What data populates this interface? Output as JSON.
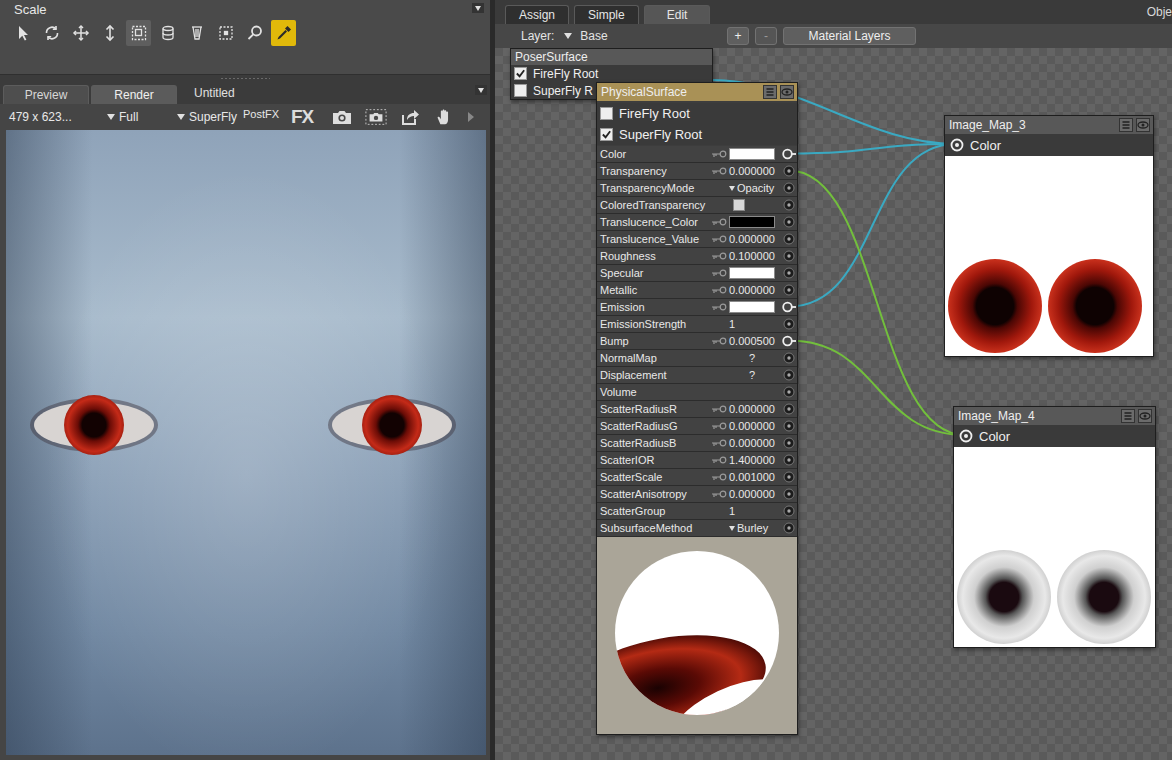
{
  "tool_panel": {
    "title": "Scale",
    "tools": [
      {
        "kind": "select",
        "selected": false,
        "highlighted": false
      },
      {
        "kind": "rotate",
        "selected": false,
        "highlighted": false
      },
      {
        "kind": "move",
        "selected": false,
        "highlighted": false
      },
      {
        "kind": "vertical",
        "selected": false,
        "highlighted": false
      },
      {
        "kind": "scale",
        "selected": false,
        "highlighted": true
      },
      {
        "kind": "layers",
        "selected": false,
        "highlighted": false
      },
      {
        "kind": "taper",
        "selected": false,
        "highlighted": false
      },
      {
        "kind": "region",
        "selected": false,
        "highlighted": false
      },
      {
        "kind": "zoom",
        "selected": false,
        "highlighted": false
      },
      {
        "kind": "eyedropper",
        "selected": true,
        "highlighted": false
      }
    ]
  },
  "render_panel": {
    "tabs": [
      {
        "label": "Preview",
        "selected": false
      },
      {
        "label": "Render",
        "selected": true
      }
    ],
    "document": "Untitled",
    "toolbar": {
      "size": "479 x 623...",
      "quality": "Full",
      "engine": "SuperFly",
      "postfx": "PostFX",
      "fx": "FX"
    }
  },
  "room_tabs": [
    {
      "label": "Assign",
      "selected": false
    },
    {
      "label": "Simple",
      "selected": false
    },
    {
      "label": "Edit",
      "selected": true
    }
  ],
  "corner_label": "Obje",
  "layer_bar": {
    "label": "Layer:",
    "value": "Base",
    "add": "+",
    "remove": "-",
    "remove_disabled": true,
    "button": "Material Layers"
  },
  "poser_surface": {
    "title": "PoserSurface",
    "roots": [
      {
        "label": "FireFly Root",
        "checked": true
      },
      {
        "label": "SuperFly R",
        "checked": false
      }
    ]
  },
  "physical_surface": {
    "title": "PhysicalSurface",
    "roots": [
      {
        "label": "FireFly Root",
        "checked": false
      },
      {
        "label": "SuperFly Root",
        "checked": true
      }
    ],
    "params": [
      {
        "name": "Color",
        "kind": "swatch",
        "color": "#ffffff",
        "keyed": true,
        "connected": true
      },
      {
        "name": "Transparency",
        "kind": "number",
        "value": "0.000000",
        "keyed": true,
        "connected": false
      },
      {
        "name": "TransparencyMode",
        "kind": "menu",
        "value": "Opacity",
        "keyed": false,
        "connected": false
      },
      {
        "name": "ColoredTransparency",
        "kind": "checkbox",
        "checked": false,
        "keyed": false,
        "connected": false
      },
      {
        "name": "Translucence_Color",
        "kind": "swatch",
        "color": "#000000",
        "keyed": true,
        "connected": false
      },
      {
        "name": "Translucence_Value",
        "kind": "number",
        "value": "0.000000",
        "keyed": true,
        "connected": false
      },
      {
        "name": "Roughness",
        "kind": "number",
        "value": "0.100000",
        "keyed": true,
        "connected": false
      },
      {
        "name": "Specular",
        "kind": "swatch",
        "color": "#ffffff",
        "keyed": true,
        "connected": false
      },
      {
        "name": "Metallic",
        "kind": "number",
        "value": "0.000000",
        "keyed": true,
        "connected": false
      },
      {
        "name": "Emission",
        "kind": "swatch",
        "color": "#ffffff",
        "keyed": true,
        "connected": true
      },
      {
        "name": "EmissionStrength",
        "kind": "number",
        "value": "1",
        "keyed": false,
        "connected": false
      },
      {
        "name": "Bump",
        "kind": "number",
        "value": "0.000500",
        "keyed": true,
        "connected": true
      },
      {
        "name": "NormalMap",
        "kind": "text",
        "value": "?",
        "keyed": false,
        "connected": false
      },
      {
        "name": "Displacement",
        "kind": "text",
        "value": "?",
        "keyed": false,
        "connected": false
      },
      {
        "name": "Volume",
        "kind": "none",
        "keyed": false,
        "connected": false
      },
      {
        "name": "ScatterRadiusR",
        "kind": "number",
        "value": "0.000000",
        "keyed": true,
        "connected": false
      },
      {
        "name": "ScatterRadiusG",
        "kind": "number",
        "value": "0.000000",
        "keyed": true,
        "connected": false
      },
      {
        "name": "ScatterRadiusB",
        "kind": "number",
        "value": "0.000000",
        "keyed": true,
        "connected": false
      },
      {
        "name": "ScatterIOR",
        "kind": "number",
        "value": "1.400000",
        "keyed": true,
        "connected": false
      },
      {
        "name": "ScatterScale",
        "kind": "number",
        "value": "0.001000",
        "keyed": true,
        "connected": false
      },
      {
        "name": "ScatterAnisotropy",
        "kind": "number",
        "value": "0.000000",
        "keyed": true,
        "connected": false
      },
      {
        "name": "ScatterGroup",
        "kind": "number",
        "value": "1",
        "keyed": false,
        "connected": false
      },
      {
        "name": "SubsurfaceMethod",
        "kind": "menu",
        "value": "Burley",
        "keyed": false,
        "connected": false
      }
    ]
  },
  "image_maps": [
    {
      "title": "Image_Map_3",
      "output": "Color",
      "kind": "red"
    },
    {
      "title": "Image_Map_4",
      "output": "Color",
      "kind": "grey"
    }
  ],
  "links": [
    {
      "from": "Image_Map_3",
      "to": "PoserSurface",
      "color": "#3aa9c2"
    },
    {
      "from": "Image_Map_3",
      "to": "Color",
      "color": "#3aa9c2"
    },
    {
      "from": "Image_Map_3",
      "to": "Emission",
      "color": "#3aa9c2"
    },
    {
      "from": "Image_Map_4",
      "to": "Transparency",
      "color": "#72bf3c"
    },
    {
      "from": "Image_Map_4",
      "to": "Bump",
      "color": "#72bf3c"
    }
  ]
}
